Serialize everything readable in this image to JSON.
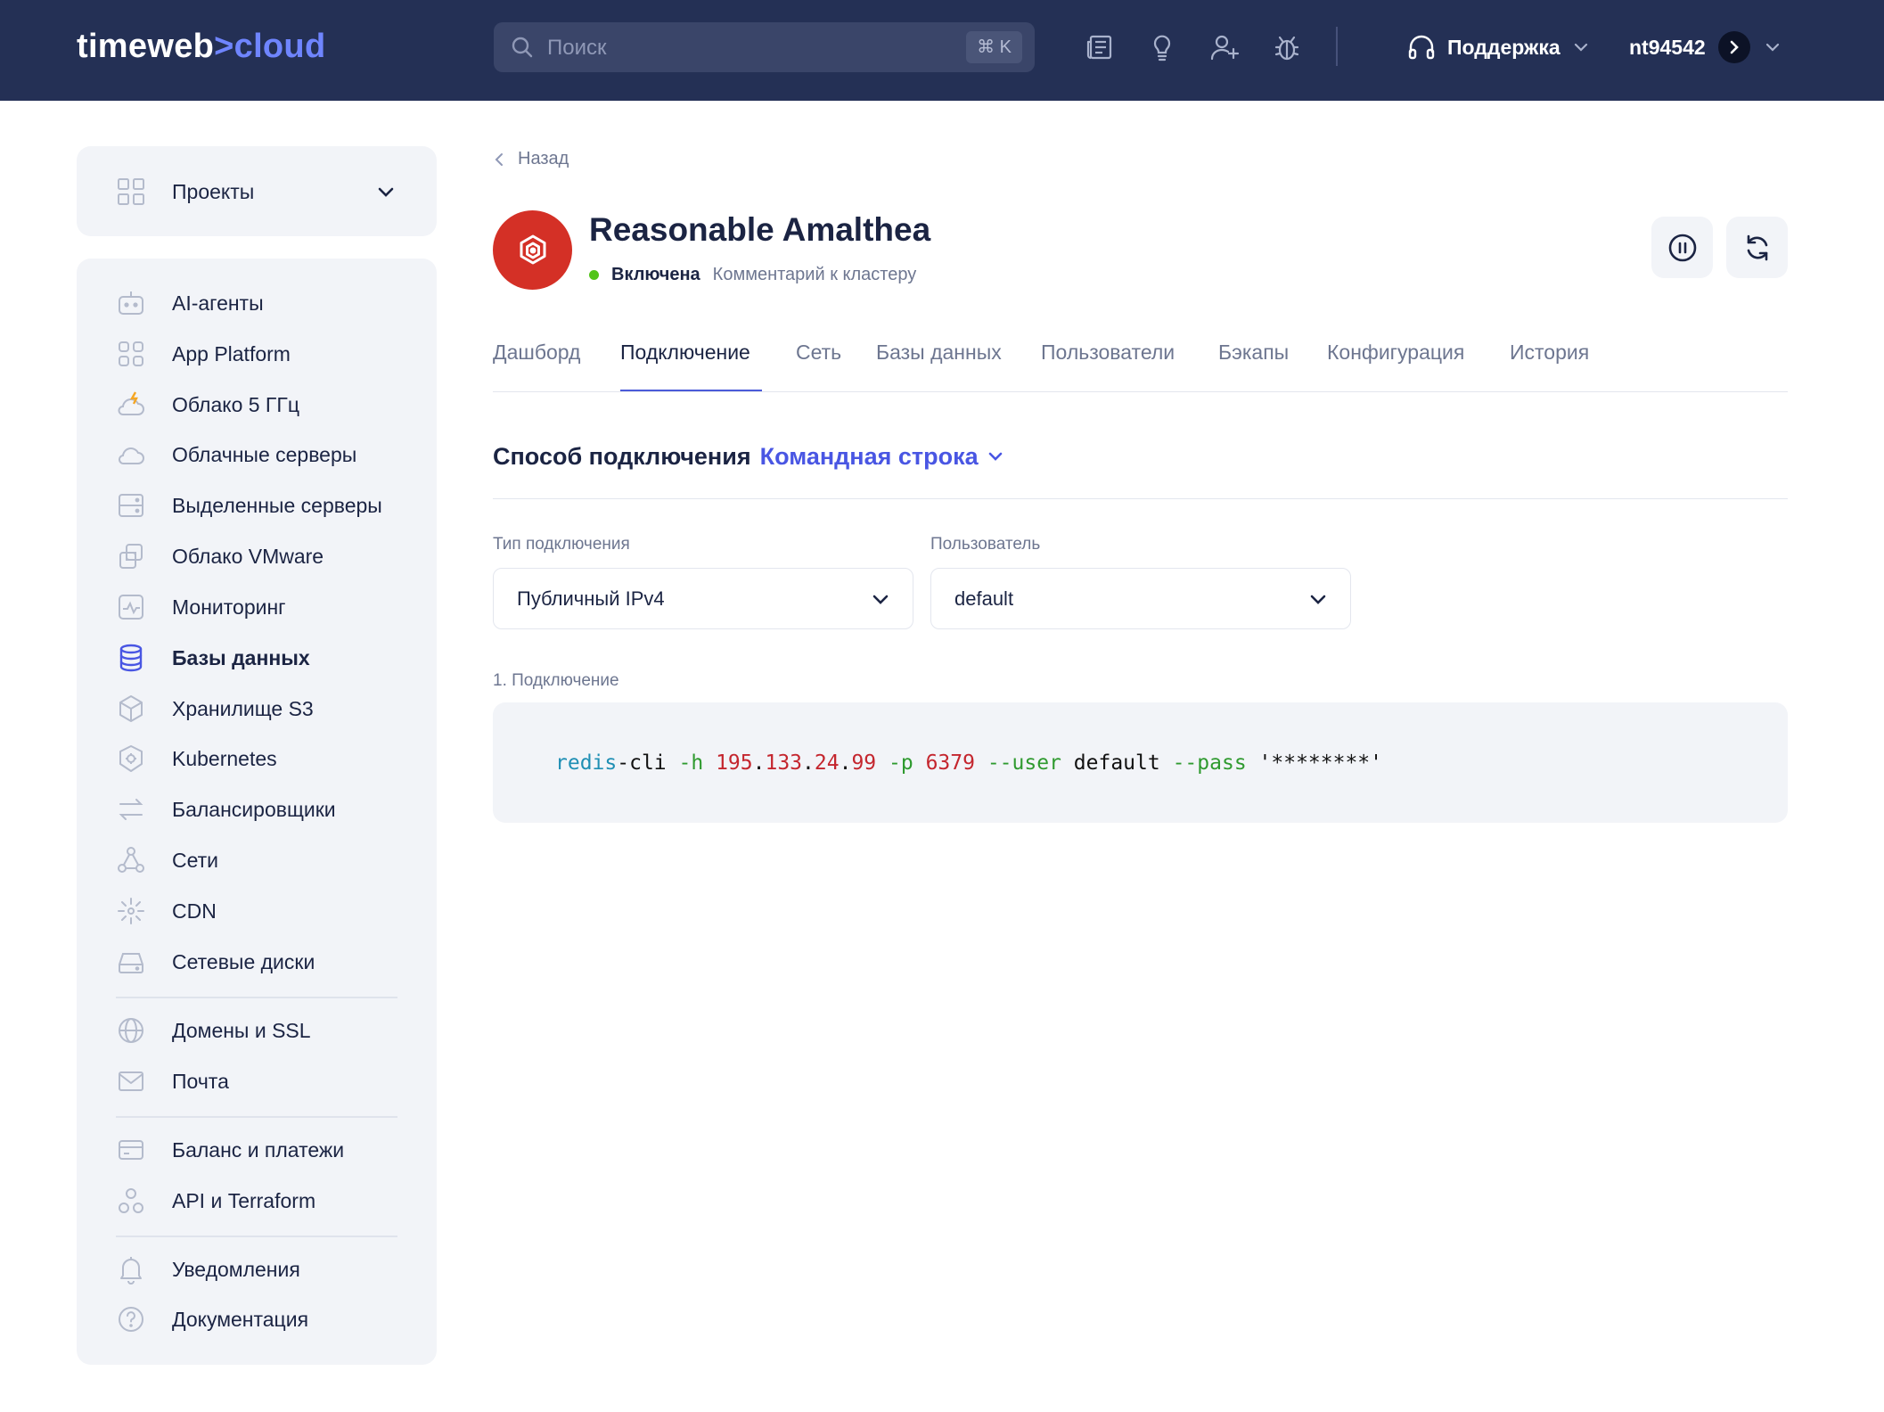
{
  "header": {
    "logo_part1": "timeweb",
    "logo_part2": ">cloud",
    "search_placeholder": "Поиск",
    "search_shortcut": "⌘ K",
    "icons": [
      "news-icon",
      "idea-icon",
      "invite-user-icon",
      "bug-icon"
    ],
    "support_label": "Поддержка",
    "account_name": "nt94542"
  },
  "sidebar": {
    "projects_label": "Проекты",
    "items": [
      {
        "label": "AI-агенты",
        "icon": "robot-icon"
      },
      {
        "label": "App Platform",
        "icon": "app-platform-icon"
      },
      {
        "label": "Облако 5 ГГц",
        "icon": "cloud-lightning-icon"
      },
      {
        "label": "Облачные серверы",
        "icon": "cloud-icon"
      },
      {
        "label": "Выделенные серверы",
        "icon": "server-icon"
      },
      {
        "label": "Облако VMware",
        "icon": "vmware-icon"
      },
      {
        "label": "Мониторинг",
        "icon": "monitoring-icon"
      },
      {
        "label": "Базы данных",
        "icon": "database-icon",
        "active": true
      },
      {
        "label": "Хранилище S3",
        "icon": "storage-box-icon"
      },
      {
        "label": "Kubernetes",
        "icon": "kubernetes-icon"
      },
      {
        "label": "Балансировщики",
        "icon": "balancer-arrows-icon"
      },
      {
        "label": "Сети",
        "icon": "network-icon"
      },
      {
        "label": "CDN",
        "icon": "cdn-icon"
      },
      {
        "label": "Сетевые диски",
        "icon": "disk-icon"
      },
      {
        "label": "Домены и SSL",
        "icon": "globe-icon"
      },
      {
        "label": "Почта",
        "icon": "mail-icon"
      },
      {
        "label": "Баланс и платежи",
        "icon": "card-icon"
      },
      {
        "label": "API и Terraform",
        "icon": "api-icon"
      },
      {
        "label": "Уведомления",
        "icon": "bell-icon"
      },
      {
        "label": "Документация",
        "icon": "help-icon"
      }
    ]
  },
  "page": {
    "back_label": "Назад",
    "db_name": "Reasonable Amalthea",
    "status": "Включена",
    "status_color": "#52c41a",
    "comment_placeholder": "Комментарий к кластеру",
    "tabs": [
      "Дашборд",
      "Подключение",
      "Сеть",
      "Базы данных",
      "Пользователи",
      "Бэкапы",
      "Конфигурация",
      "История"
    ],
    "active_tab": "Подключение",
    "connection_method_label": "Способ подключения",
    "connection_method_value": "Командная строка",
    "connection_type_label": "Тип подключения",
    "connection_type_value": "Публичный IPv4",
    "user_label": "Пользователь",
    "user_value": "default",
    "step_label": "1. Подключение",
    "command": {
      "cmd": "redis",
      "dash": "-",
      "cli": "cli",
      "flag_h": "-h",
      "ip1": "195",
      "ip2": "133",
      "ip3": "24",
      "ip4": "99",
      "dot": ".",
      "flag_p": "-p",
      "port": "6379",
      "flag_user": "--user",
      "user": "default",
      "flag_pass": "--pass",
      "pass": "'********'"
    },
    "accent_color": "#4956e3",
    "avatar_color": "#d43026"
  }
}
